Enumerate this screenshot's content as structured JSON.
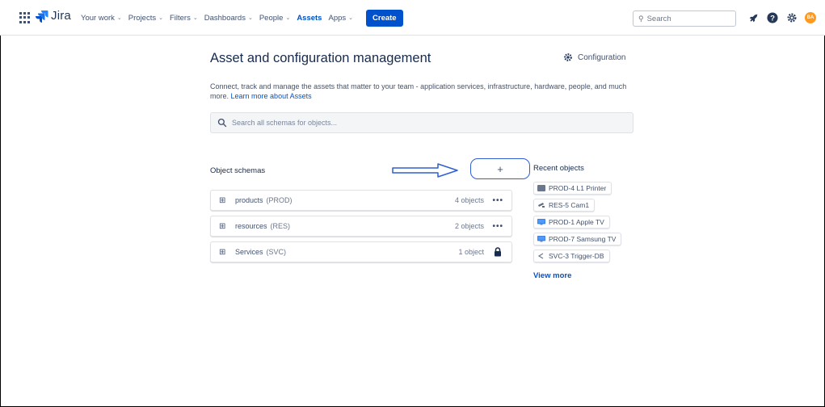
{
  "nav": {
    "logo_text": "Jira",
    "items": [
      {
        "label": "Your work",
        "chevron": true
      },
      {
        "label": "Projects",
        "chevron": true
      },
      {
        "label": "Filters",
        "chevron": true
      },
      {
        "label": "Dashboards",
        "chevron": true
      },
      {
        "label": "People",
        "chevron": true
      },
      {
        "label": "Assets",
        "chevron": false,
        "active": true
      },
      {
        "label": "Apps",
        "chevron": true
      }
    ],
    "create_label": "Create",
    "search_placeholder": "Search",
    "avatar_initials": "BA"
  },
  "page": {
    "title": "Asset and configuration management",
    "config_label": "Configuration",
    "description": "Connect, track and manage the assets that matter to your team - application services, infrastructure, hardware, people, and much more.",
    "learn_more": "Learn more about Assets",
    "search_placeholder": "Search all schemas for objects...",
    "add_label": "+"
  },
  "schemas": {
    "title": "Object schemas",
    "rows": [
      {
        "name": "products",
        "key": "(PROD)",
        "count": "4 objects",
        "action": "more"
      },
      {
        "name": "resources",
        "key": "(RES)",
        "count": "2 objects",
        "action": "more"
      },
      {
        "name": "Services",
        "key": "(SVC)",
        "count": "1 object",
        "action": "lock"
      }
    ]
  },
  "recent": {
    "title": "Recent objects",
    "items": [
      {
        "label": "PROD-4 L1 Printer",
        "icon": "printer-icon"
      },
      {
        "label": "RES-5 Cam1",
        "icon": "camera-icon"
      },
      {
        "label": "PROD-1 Apple TV",
        "icon": "tv-icon"
      },
      {
        "label": "PROD-7 Samsung TV",
        "icon": "tv-icon"
      },
      {
        "label": "SVC-3 Trigger-DB",
        "icon": "service-icon"
      }
    ],
    "view_more": "View more"
  },
  "colors": {
    "brand_blue": "#0052cc",
    "text": "#172b4d",
    "subtle": "#42526e",
    "annotation_blue": "#2f5fd0",
    "avatar": "#ff991f"
  }
}
